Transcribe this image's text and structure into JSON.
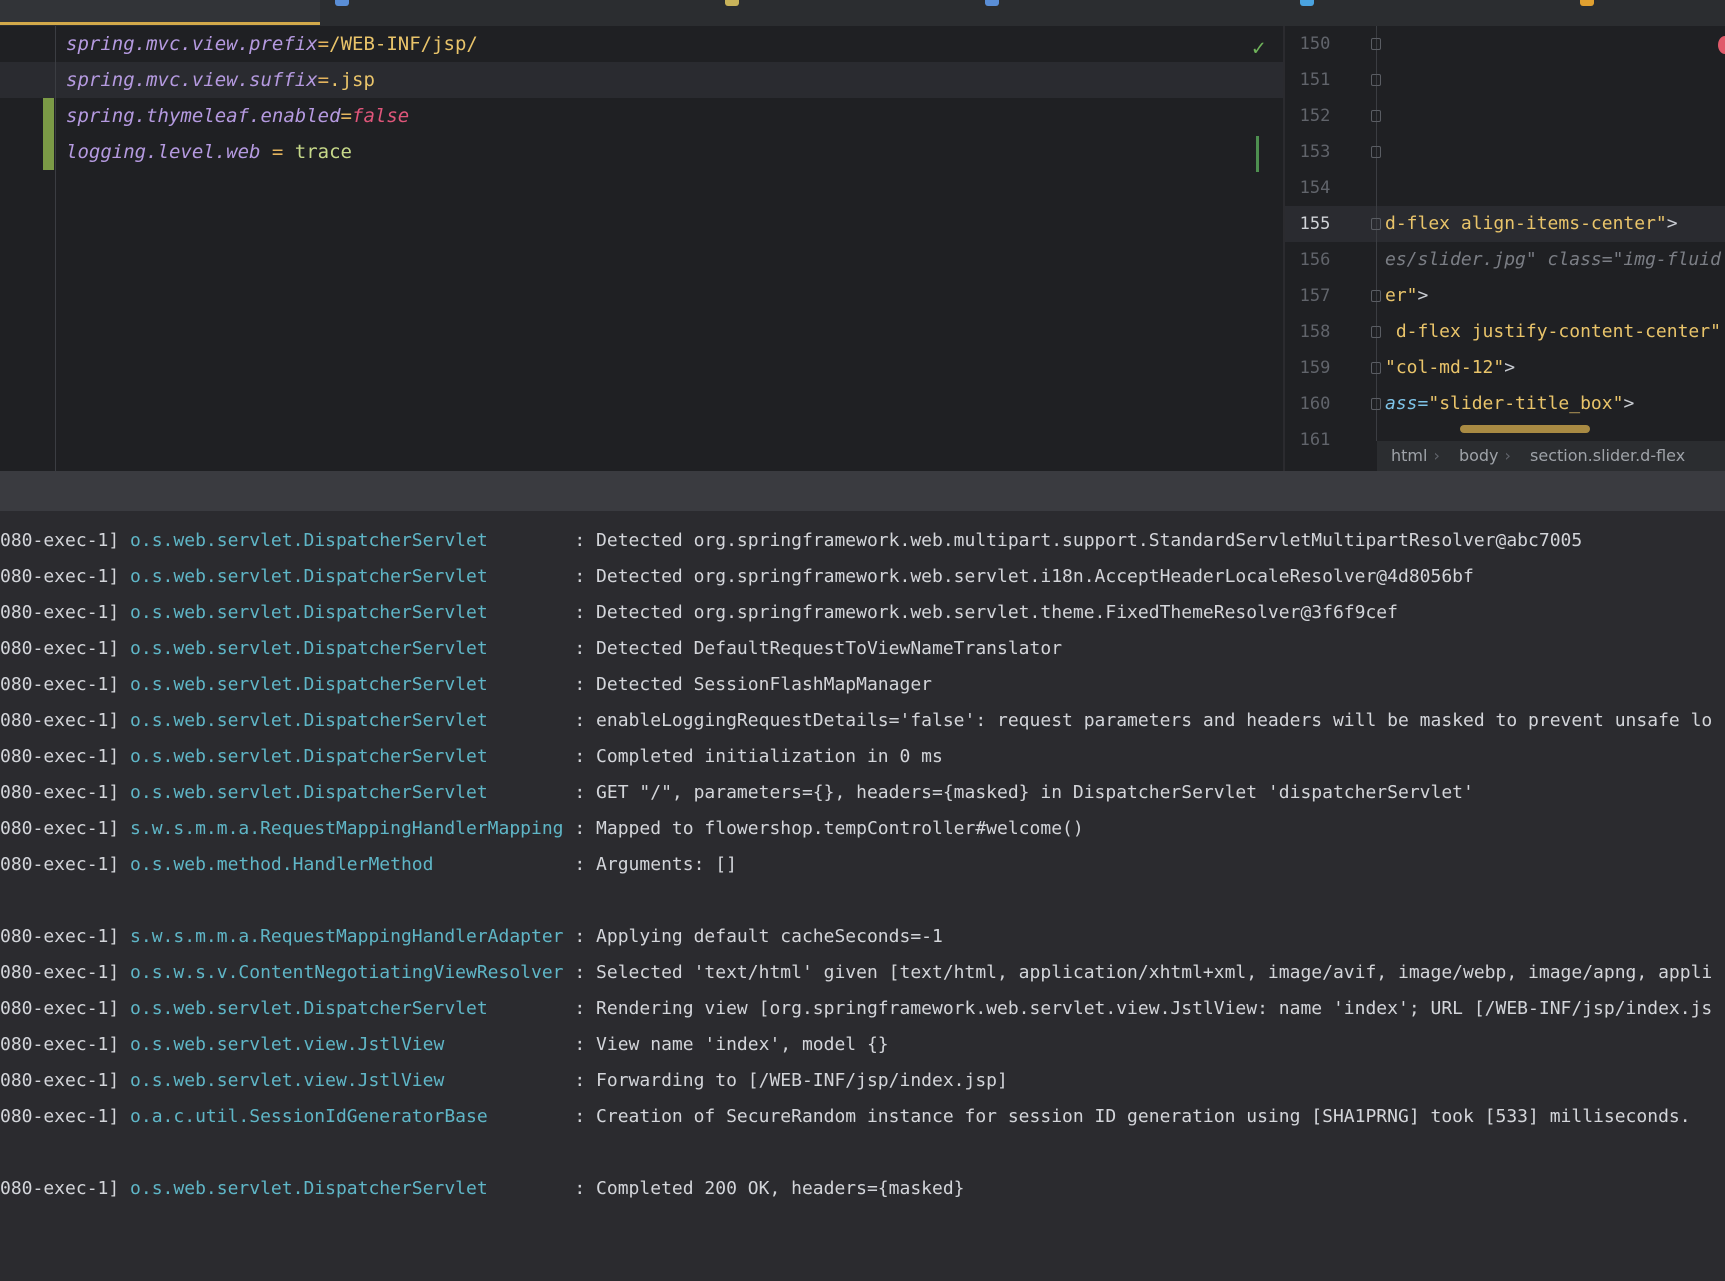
{
  "left_editor": {
    "lines": [
      {
        "key": "spring.mvc.view.prefix",
        "op": "=",
        "value": "/WEB-INF/jsp/",
        "type": "path"
      },
      {
        "key": "spring.mvc.view.suffix",
        "op": "=",
        "value": ".jsp",
        "type": "path"
      },
      {
        "key": "spring.thymeleaf.enabled",
        "op": "=",
        "value": "false",
        "type": "bool"
      },
      {
        "key": "logging.level.web",
        "op": " = ",
        "value": "trace",
        "type": "plain"
      }
    ],
    "status_icon": "check-icon"
  },
  "right_editor": {
    "line_numbers": [
      "150",
      "151",
      "152",
      "153",
      "154",
      "155",
      "156",
      "157",
      "158",
      "159",
      "160",
      "161"
    ],
    "current_line": "155",
    "code": [
      {
        "line": "155",
        "parts": [
          {
            "t": "d-flex align-items-center\"",
            "c": "s"
          },
          {
            "t": ">",
            "c": "tg"
          }
        ]
      },
      {
        "line": "156",
        "parts": [
          {
            "t": "es/slider.jpg\" class=\"img-fluid",
            "c": "cm"
          }
        ]
      },
      {
        "line": "157",
        "parts": [
          {
            "t": "er\"",
            "c": "s"
          },
          {
            "t": ">",
            "c": "tg"
          }
        ]
      },
      {
        "line": "158",
        "parts": [
          {
            "t": " d-flex justify-content-center\"",
            "c": "s"
          }
        ]
      },
      {
        "line": "159",
        "parts": [
          {
            "t": "\"col-md-12\"",
            "c": "s"
          },
          {
            "t": ">",
            "c": "tg"
          }
        ]
      },
      {
        "line": "160",
        "parts": [
          {
            "t": "ass=",
            "c": "at"
          },
          {
            "t": "\"slider-title_box\"",
            "c": "s"
          },
          {
            "t": ">",
            "c": "tg"
          }
        ]
      }
    ],
    "breadcrumb": [
      "html",
      "body",
      "section.slider.d-flex"
    ]
  },
  "console": {
    "lines": [
      {
        "thread": "080-exec-1]",
        "logger": "o.s.web.servlet.DispatcherServlet",
        "msg": "Detected org.springframework.web.multipart.support.StandardServletMultipartResolver@abc7005"
      },
      {
        "thread": "080-exec-1]",
        "logger": "o.s.web.servlet.DispatcherServlet",
        "msg": "Detected org.springframework.web.servlet.i18n.AcceptHeaderLocaleResolver@4d8056bf"
      },
      {
        "thread": "080-exec-1]",
        "logger": "o.s.web.servlet.DispatcherServlet",
        "msg": "Detected org.springframework.web.servlet.theme.FixedThemeResolver@3f6f9cef"
      },
      {
        "thread": "080-exec-1]",
        "logger": "o.s.web.servlet.DispatcherServlet",
        "msg": "Detected DefaultRequestToViewNameTranslator"
      },
      {
        "thread": "080-exec-1]",
        "logger": "o.s.web.servlet.DispatcherServlet",
        "msg": "Detected SessionFlashMapManager"
      },
      {
        "thread": "080-exec-1]",
        "logger": "o.s.web.servlet.DispatcherServlet",
        "msg": "enableLoggingRequestDetails='false': request parameters and headers will be masked to prevent unsafe lo"
      },
      {
        "thread": "080-exec-1]",
        "logger": "o.s.web.servlet.DispatcherServlet",
        "msg": "Completed initialization in 0 ms"
      },
      {
        "thread": "080-exec-1]",
        "logger": "o.s.web.servlet.DispatcherServlet",
        "msg": "GET \"/\", parameters={}, headers={masked} in DispatcherServlet 'dispatcherServlet'"
      },
      {
        "thread": "080-exec-1]",
        "logger": "s.w.s.m.m.a.RequestMappingHandlerMapping",
        "msg": "Mapped to flowershop.tempController#welcome()"
      },
      {
        "thread": "080-exec-1]",
        "logger": "o.s.web.method.HandlerMethod",
        "msg": "Arguments: []"
      },
      {
        "thread": "",
        "logger": "",
        "msg": ""
      },
      {
        "thread": "080-exec-1]",
        "logger": "s.w.s.m.m.a.RequestMappingHandlerAdapter",
        "msg": "Applying default cacheSeconds=-1"
      },
      {
        "thread": "080-exec-1]",
        "logger": "o.s.w.s.v.ContentNegotiatingViewResolver",
        "msg": "Selected 'text/html' given [text/html, application/xhtml+xml, image/avif, image/webp, image/apng, appli"
      },
      {
        "thread": "080-exec-1]",
        "logger": "o.s.web.servlet.DispatcherServlet",
        "msg": "Rendering view [org.springframework.web.servlet.view.JstlView: name 'index'; URL [/WEB-INF/jsp/index.js"
      },
      {
        "thread": "080-exec-1]",
        "logger": "o.s.web.servlet.view.JstlView",
        "msg": "View name 'index', model {}"
      },
      {
        "thread": "080-exec-1]",
        "logger": "o.s.web.servlet.view.JstlView",
        "msg": "Forwarding to [/WEB-INF/jsp/index.jsp]"
      },
      {
        "thread": "080-exec-1]",
        "logger": "o.a.c.util.SessionIdGeneratorBase",
        "msg": "Creation of SecureRandom instance for session ID generation using [SHA1PRNG] took [533] milliseconds."
      },
      {
        "thread": "",
        "logger": "",
        "msg": ""
      },
      {
        "thread": "080-exec-1]",
        "logger": "o.s.web.servlet.DispatcherServlet",
        "msg": "Completed 200 OK, headers={masked}"
      }
    ]
  },
  "colors": {
    "accent": "#d2a94a",
    "logger": "#5fb6c7",
    "key": "#b59ae0",
    "value": "#e9c46a",
    "false": "#e0567a",
    "trace": "#c7d98a"
  }
}
